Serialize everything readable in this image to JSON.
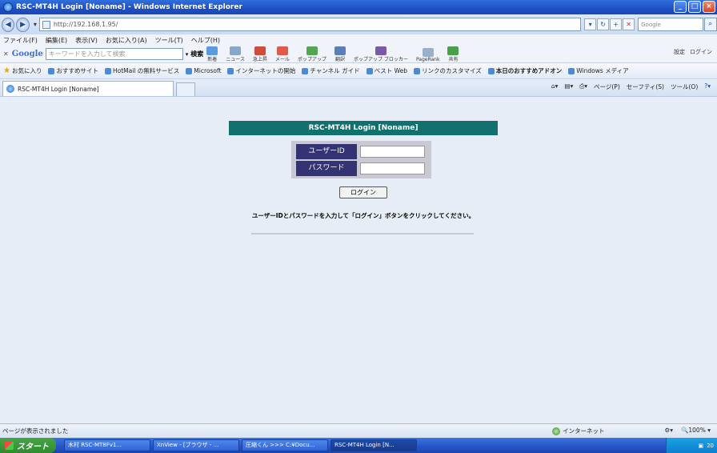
{
  "window": {
    "title": "RSC-MT4H Login [Noname] - Windows Internet Explorer",
    "buttons": [
      "_",
      "□",
      "×"
    ]
  },
  "address_bar": {
    "url": "http://192.168.1.95/",
    "search_placeholder": "Google"
  },
  "menu": [
    "ファイル(F)",
    "編集(E)",
    "表示(V)",
    "お気に入り(A)",
    "ツール(T)",
    "ヘルプ(H)"
  ],
  "google_toolbar": {
    "logo": "Google",
    "search_placeholder": "キーワードを入力して検索",
    "search_button": "検索",
    "tools": [
      "新着",
      "ニュース",
      "急上昇",
      "メール",
      "ポップアップ",
      "翻訳",
      "ポップアップ ブロッカー",
      "PageRank",
      "共有"
    ],
    "settings": "設定",
    "login": "ログイン"
  },
  "favorites_bar": {
    "favorites": "お気に入り",
    "items": [
      "おすすめサイト",
      "HotMail の無料サービス",
      "Microsoft",
      "インターネットの開始",
      "チャンネル ガイド",
      "ベスト Web",
      "リンクのカスタマイズ",
      "本日のおすすめアドオン",
      "Windows メディア"
    ]
  },
  "tabs": [
    {
      "label": "RSC-MT4H Login [Noname]"
    }
  ],
  "command_bar": [
    "ページ(P)",
    "セーフティ(S)",
    "ツール(O)"
  ],
  "page": {
    "header": "RSC-MT4H Login [Noname]",
    "user_id_label": "ユーザーID",
    "user_id_value": "",
    "password_label": "パスワード",
    "password_value": "",
    "login_button": "ログイン",
    "instruction": "ユーザーIDとパスワードを入力して「ログイン」ボタンをクリックしてください。"
  },
  "status_bar": {
    "text": "ページが表示されました",
    "zone": "インターネット",
    "zoom": "100%"
  },
  "taskbar": {
    "start": "スタート",
    "tasks": [
      "木村 RSC-MT8Fv1...",
      "XnView - [ブラウザ - ...",
      "圧縮くん >>> C:¥Docu...",
      "RSC-MT4H Login [N..."
    ],
    "clock": "20"
  }
}
